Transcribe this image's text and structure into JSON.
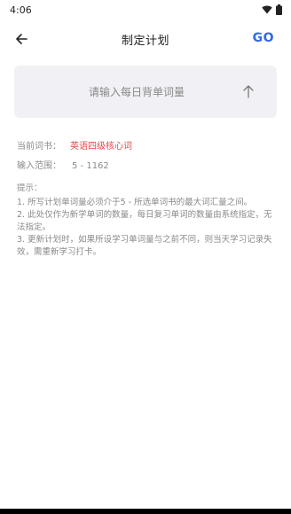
{
  "status_bar": {
    "time": "4:06"
  },
  "header": {
    "title": "制定计划",
    "go_label": "GO"
  },
  "input": {
    "placeholder": "请输入每日背单词量",
    "value": ""
  },
  "info": {
    "book_label": "当前词书：",
    "book_value": "英语四级核心词",
    "range_label": "输入范围：",
    "range_value": "5 - 1162"
  },
  "tips": {
    "title": "提示：",
    "items": [
      "1. 所写计划单词量必须介于5 - 所选单词书的最大词汇量之间。",
      "2. 此处仅作为新学单词的数量，每日复习单词的数量由系统指定，无法指定。",
      "3. 更新计划时，如果所设学习单词量与之前不同，则当天学习记录失效，需重新学习打卡。"
    ]
  },
  "colors": {
    "accent": "#2f6be5",
    "book_value": "#e24a4a",
    "card_bg": "#f1f1f5",
    "muted_text": "#8a8a8a"
  },
  "icons": {
    "back": "arrow-left-icon",
    "submit": "arrow-up-icon",
    "wifi": "wifi-icon",
    "battery": "battery-icon"
  }
}
